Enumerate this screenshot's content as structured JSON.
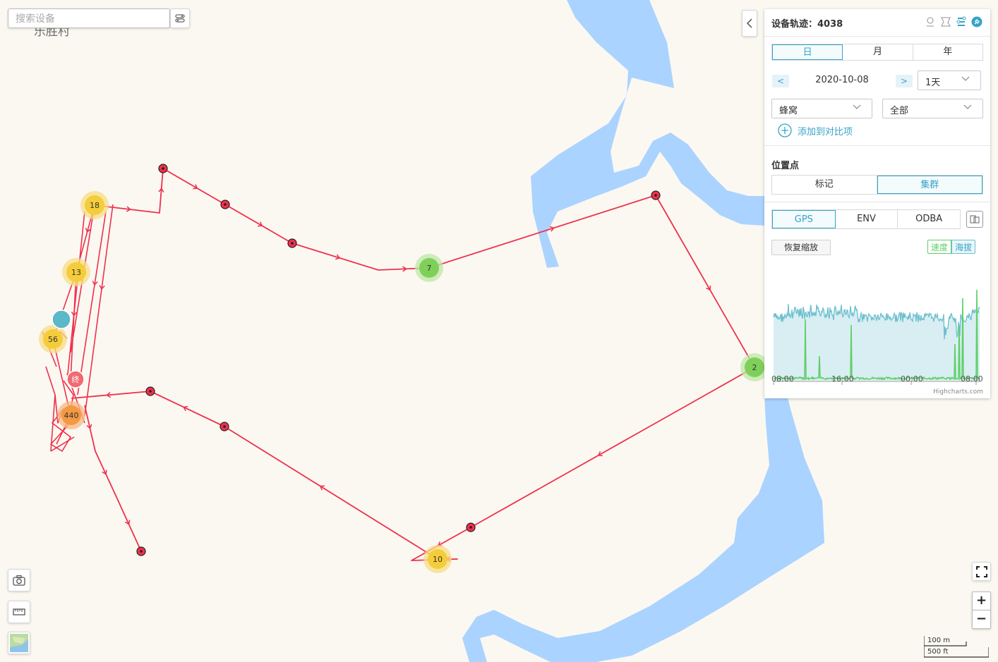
{
  "map": {
    "place_label": "乐胜村",
    "search_placeholder": "搜索设备",
    "cluster_counts": [
      "18",
      "13",
      "56",
      "440",
      "7",
      "2",
      "10"
    ],
    "end_marker_label": "终",
    "scale": {
      "m": "100 m",
      "ft": "500 ft"
    },
    "zoom_in": "+",
    "zoom_out": "−"
  },
  "panel": {
    "title": "设备轨迹：4038",
    "period_tabs": [
      "日",
      "月",
      "年"
    ],
    "active_period": "日",
    "prev": "<",
    "next": ">",
    "date": "2020-10-08",
    "range": "1天",
    "select_1": "蜂窝",
    "select_2": "全部",
    "add_compare": "添加到对比项",
    "points_section": "位置点",
    "point_modes": [
      "标记",
      "集群"
    ],
    "active_point_mode": "集群",
    "sensor_tabs": [
      "GPS",
      "ENV",
      "ODBA"
    ],
    "active_sensor": "GPS",
    "reset_zoom": "恢复缩放",
    "metric_speed": "速度",
    "metric_altitude": "海拔",
    "credit": "Highcharts.com"
  },
  "chart_data": {
    "type": "area",
    "x_tick_labels": [
      "08:00",
      "16:00",
      "00:00",
      "08:00"
    ],
    "series": [
      {
        "name": "海拔",
        "color": "#6cbfcf"
      },
      {
        "name": "速度",
        "color": "#5fcf6a"
      }
    ]
  },
  "colors": {
    "accent": "#36a3c6",
    "track": "#f0304b",
    "water": "#aad3ff",
    "speed": "#5fcf6a",
    "altitude": "#6cbfcf"
  }
}
